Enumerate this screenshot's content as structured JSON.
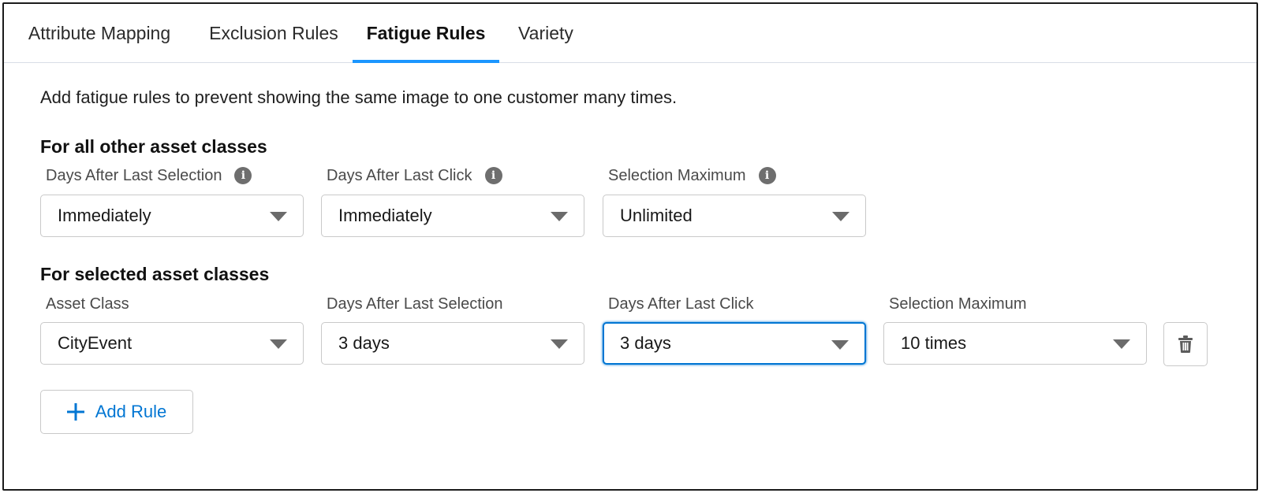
{
  "tabs": [
    {
      "label": "Attribute Mapping",
      "active": false
    },
    {
      "label": "Exclusion Rules",
      "active": false
    },
    {
      "label": "Fatigue Rules",
      "active": true
    },
    {
      "label": "Variety",
      "active": false
    }
  ],
  "description": "Add fatigue rules to prevent showing the same image to one customer many times.",
  "all_classes": {
    "title": "For all other asset classes",
    "fields": [
      {
        "label": "Days After Last Selection",
        "value": "Immediately"
      },
      {
        "label": "Days After Last Click",
        "value": "Immediately"
      },
      {
        "label": "Selection Maximum",
        "value": "Unlimited"
      }
    ]
  },
  "selected_classes": {
    "title": "For selected asset classes",
    "headers": [
      "Asset Class",
      "Days After Last Selection",
      "Days After Last Click",
      "Selection Maximum"
    ],
    "rows": [
      {
        "asset_class": "CityEvent",
        "days_after_selection": "3 days",
        "days_after_click": "3 days",
        "selection_maximum": "10 times"
      }
    ]
  },
  "info_glyph": "i",
  "add_rule_label": "Add Rule",
  "icons": {
    "info": "info-icon",
    "caret": "chevron-down-icon",
    "delete": "trash-icon",
    "add": "plus-icon"
  },
  "colors": {
    "accent": "#0176d3",
    "tab_underline": "#1b96ff",
    "border": "#c9c9c9"
  }
}
